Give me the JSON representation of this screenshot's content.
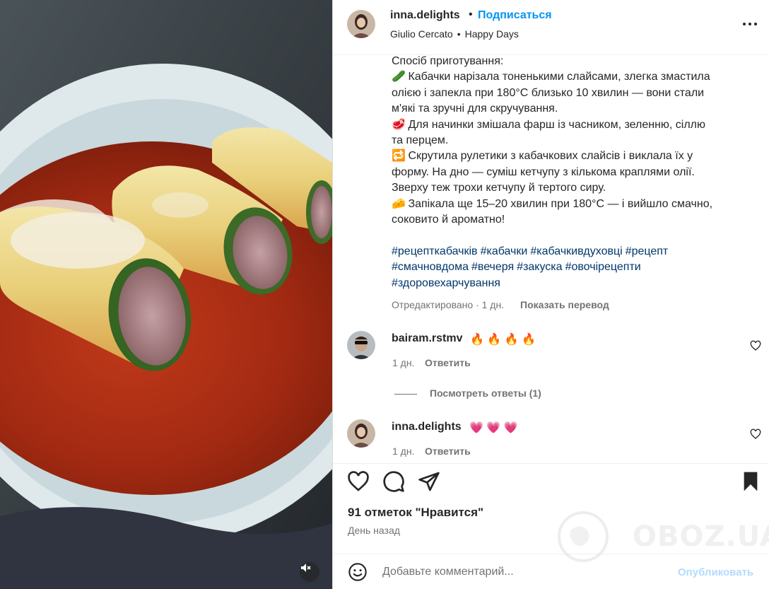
{
  "post": {
    "username": "inna.delights",
    "follow_label": "Подписаться",
    "dot": "•",
    "audio": {
      "artist": "Giulio Cercato",
      "separator": "•",
      "track": "Happy Days"
    },
    "more_icon": "more-horizontal-icon",
    "caption_lines": [
      {
        "emoji": "",
        "text": "Спосіб приготування:"
      },
      {
        "emoji": "🥒",
        "text": "Кабачки нарізала тоненькими слайсами, злегка змастила"
      },
      {
        "emoji": "",
        "text": "олією і запекла при 180°C близько 10 хвилин — вони стали"
      },
      {
        "emoji": "",
        "text": "м'які та зручні для скручування."
      },
      {
        "emoji": "🥩",
        "text": "Для начинки змішала фарш із часником, зеленню, сіллю"
      },
      {
        "emoji": "",
        "text": "та перцем."
      },
      {
        "emoji": "🔁",
        "text": "Скрутила рулетики з кабачкових слайсів і виклала їх у"
      },
      {
        "emoji": "",
        "text": "форму. На дно — суміш кетчупу з кількома краплями олії."
      },
      {
        "emoji": "",
        "text": "Зверху теж трохи кетчупу й тертого сиру."
      },
      {
        "emoji": "🧀",
        "text": "Запікала ще 15–20 хвилин при 180°C — і вийшло смачно,"
      },
      {
        "emoji": "",
        "text": "соковито й ароматно!"
      }
    ],
    "hashtag_lines": [
      [
        "#рецепткабачків",
        "#кабачки",
        "#кабачкивдуховці",
        "#рецепт"
      ],
      [
        "#смачновдома",
        "#вечеря",
        "#закуска",
        "#овочірецепти"
      ],
      [
        "#здоровехарчування"
      ]
    ],
    "edited_meta": "Отредактировано · 1 дн.",
    "translate_label": "Показать перевод"
  },
  "comments": [
    {
      "username": "bairam.rstmv",
      "text": "🔥 🔥 🔥 🔥",
      "time": "1 дн.",
      "reply_label": "Ответить"
    },
    {
      "username": "inna.delights",
      "text": "💗 💗 💗",
      "time": "1 дн.",
      "reply_label": "Ответить"
    }
  ],
  "view_replies_label": "Посмотреть ответы (1)",
  "actions": {
    "like_icon": "heart-icon",
    "comment_icon": "comment-icon",
    "share_icon": "send-icon",
    "save_icon": "bookmark-icon"
  },
  "likes_text": "91 отметок \"Нравится\"",
  "posted_text": "День назад",
  "add_comment": {
    "placeholder": "Добавьте комментарий...",
    "publish_label": "Опубликовать"
  },
  "watermark": "OBOZ.UA",
  "media": {
    "mute_icon": "speaker-muted-icon"
  },
  "colors": {
    "link": "#0095f6",
    "hashtag": "#00376b",
    "secondary_text": "#737373",
    "publish_disabled": "#b3dbff"
  }
}
